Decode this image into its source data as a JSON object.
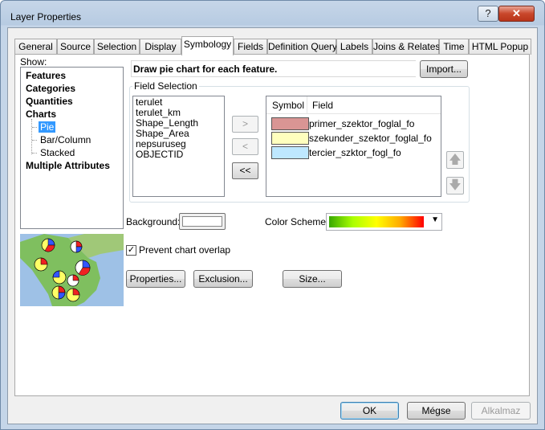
{
  "window": {
    "title": "Layer Properties",
    "help_label": "?",
    "close_label": "✕"
  },
  "tabs": [
    {
      "label": "General"
    },
    {
      "label": "Source"
    },
    {
      "label": "Selection"
    },
    {
      "label": "Display"
    },
    {
      "label": "Symbology",
      "active": true
    },
    {
      "label": "Fields"
    },
    {
      "label": "Definition Query"
    },
    {
      "label": "Labels"
    },
    {
      "label": "Joins & Relates"
    },
    {
      "label": "Time"
    },
    {
      "label": "HTML Popup"
    }
  ],
  "show": {
    "label": "Show:",
    "items": {
      "features": "Features",
      "categories": "Categories",
      "quantities": "Quantities",
      "charts": "Charts",
      "pie": "Pie",
      "bar_column": "Bar/Column",
      "stacked": "Stacked",
      "multiple": "Multiple Attributes"
    }
  },
  "description": "Draw pie chart for each feature.",
  "import_label": "Import...",
  "field_selection": {
    "legend": "Field Selection",
    "fields": [
      "terulet",
      "terulet_km",
      "Shape_Length",
      "Shape_Area",
      "nepsuruseg",
      "OBJECTID"
    ],
    "add_label": ">",
    "remove_label": "<",
    "remove_all_label": "<<",
    "header_symbol": "Symbol",
    "header_field": "Field",
    "selected": [
      {
        "field": "primer_szektor_foglal_fo",
        "color": "#d99594"
      },
      {
        "field": "szekunder_szektor_foglal_fo",
        "color": "#ffffbe"
      },
      {
        "field": "tercier_szktor_fogl_fo",
        "color": "#bee8ff"
      }
    ],
    "up_icon": "🡅",
    "down_icon": "🡇"
  },
  "background_label": "Background:",
  "color_scheme_label": "Color  Scheme:",
  "prevent_overlap": {
    "label": "Prevent chart overlap",
    "checked": true,
    "mark": "✓"
  },
  "buttons": {
    "properties": "Properties...",
    "exclusion": "Exclusion...",
    "size": "Size...",
    "ok": "OK",
    "cancel": "Mégse",
    "apply": "Alkalmaz"
  }
}
